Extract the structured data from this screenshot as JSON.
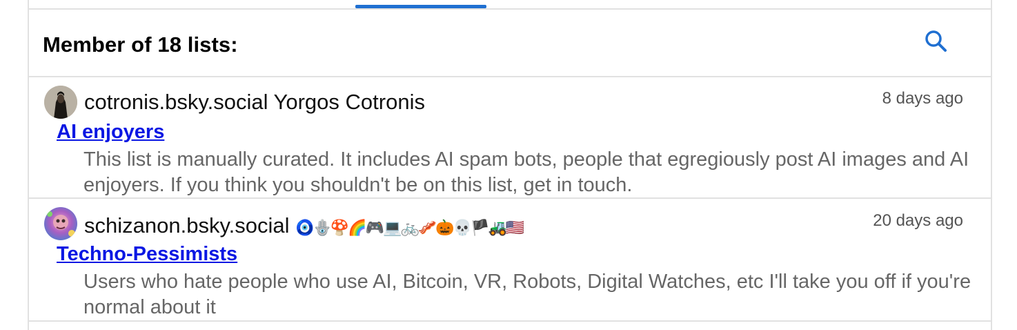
{
  "header": {
    "title": "Member of 18 lists:"
  },
  "lists": [
    {
      "author_handle": "cotronis.bsky.social",
      "author_name": "Yorgos Cotronis",
      "time": "8 days ago",
      "list_name": "AI enjoyers",
      "description": "This list is manually curated. It includes AI spam bots, people that egregiously post AI images and AI enjoyers. If you think you shouldn't be on this list, get in touch."
    },
    {
      "author_handle": "schizanon.bsky.social",
      "author_name": "🧿🪬🍄🌈🎮💻🚲🥓🎃💀🏴🚜🇺🇸",
      "time": "20 days ago",
      "list_name": "Techno-Pessimists",
      "description": "Users who hate people who use AI, Bitcoin, VR, Robots, Digital Watches, etc I'll take you off if you're normal about it"
    }
  ],
  "colors": {
    "accent": "#1f6fd1",
    "link": "#0a17e3",
    "border": "#e1e1e1"
  },
  "icons": {
    "search": "search-icon"
  }
}
